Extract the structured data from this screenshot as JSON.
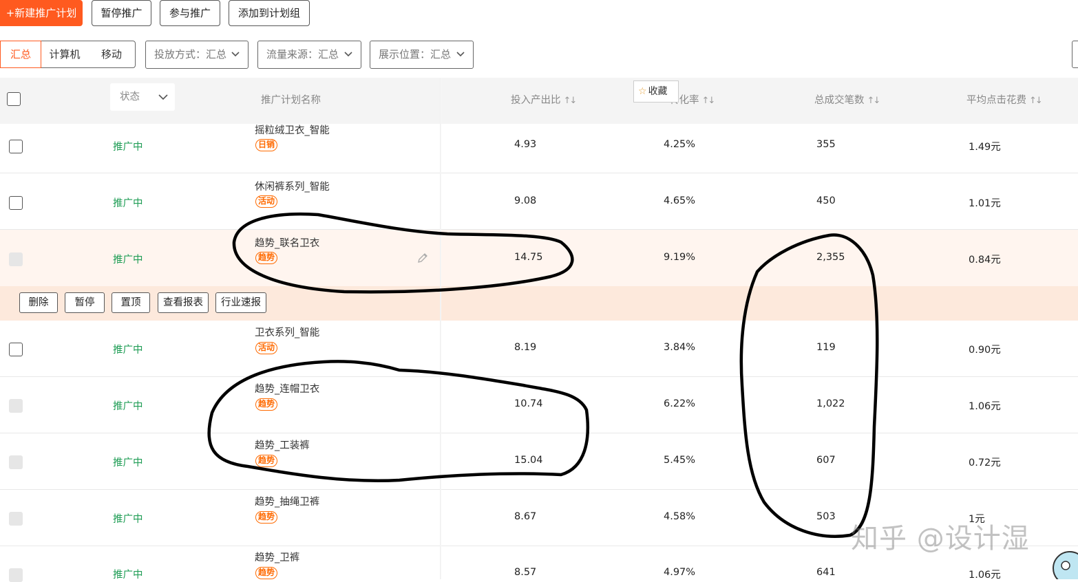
{
  "toolbar": {
    "new_plan": "+新建推广计划",
    "pause": "暂停推广",
    "join": "参与推广",
    "add_group": "添加到计划组"
  },
  "filters": {
    "device_tabs": [
      "汇总",
      "计算机",
      "移动"
    ],
    "delivery": "投放方式：汇总",
    "traffic": "流量来源：汇总",
    "position": "展示位置：汇总"
  },
  "table": {
    "headers": {
      "status": "状态",
      "name": "推广计划名称",
      "roi": "投入产出比",
      "cvr": "转化率",
      "orders": "总成交笔数",
      "cpc": "平均点击花费",
      "sort": "↑↓"
    },
    "favorite": "收藏",
    "rows": [
      {
        "name": "摇粒绒卫衣_智能",
        "tag": "日销",
        "status": "推广中",
        "roi": "4.93",
        "cvr": "4.25%",
        "orders": "355",
        "cpc": "1.49元"
      },
      {
        "name": "休闲裤系列_智能",
        "tag": "活动",
        "status": "推广中",
        "roi": "9.08",
        "cvr": "4.65%",
        "orders": "450",
        "cpc": "1.01元"
      },
      {
        "name": "趋势_联名卫衣",
        "tag": "趋势",
        "status": "推广中",
        "roi": "14.75",
        "cvr": "9.19%",
        "orders": "2,355",
        "cpc": "0.84元"
      },
      {
        "name": "卫衣系列_智能",
        "tag": "活动",
        "status": "推广中",
        "roi": "8.19",
        "cvr": "3.84%",
        "orders": "119",
        "cpc": "0.90元"
      },
      {
        "name": "趋势_连帽卫衣",
        "tag": "趋势",
        "status": "推广中",
        "roi": "10.74",
        "cvr": "6.22%",
        "orders": "1,022",
        "cpc": "1.06元"
      },
      {
        "name": "趋势_工装裤",
        "tag": "趋势",
        "status": "推广中",
        "roi": "15.04",
        "cvr": "5.45%",
        "orders": "607",
        "cpc": "0.72元"
      },
      {
        "name": "趋势_抽绳卫裤",
        "tag": "趋势",
        "status": "推广中",
        "roi": "8.67",
        "cvr": "4.58%",
        "orders": "503",
        "cpc": "1元"
      },
      {
        "name": "趋势_卫裤",
        "tag": "趋势",
        "status": "推广中",
        "roi": "8.57",
        "cvr": "4.97%",
        "orders": "641",
        "cpc": "1.06元"
      }
    ],
    "row_actions": [
      "删除",
      "暂停",
      "置顶",
      "查看报表",
      "行业速报"
    ]
  },
  "watermark": "知乎 @设计湿",
  "colors": {
    "accent": "#ff5a1f",
    "status_green": "#1f9d55",
    "tag_orange": "#ff6a00"
  }
}
